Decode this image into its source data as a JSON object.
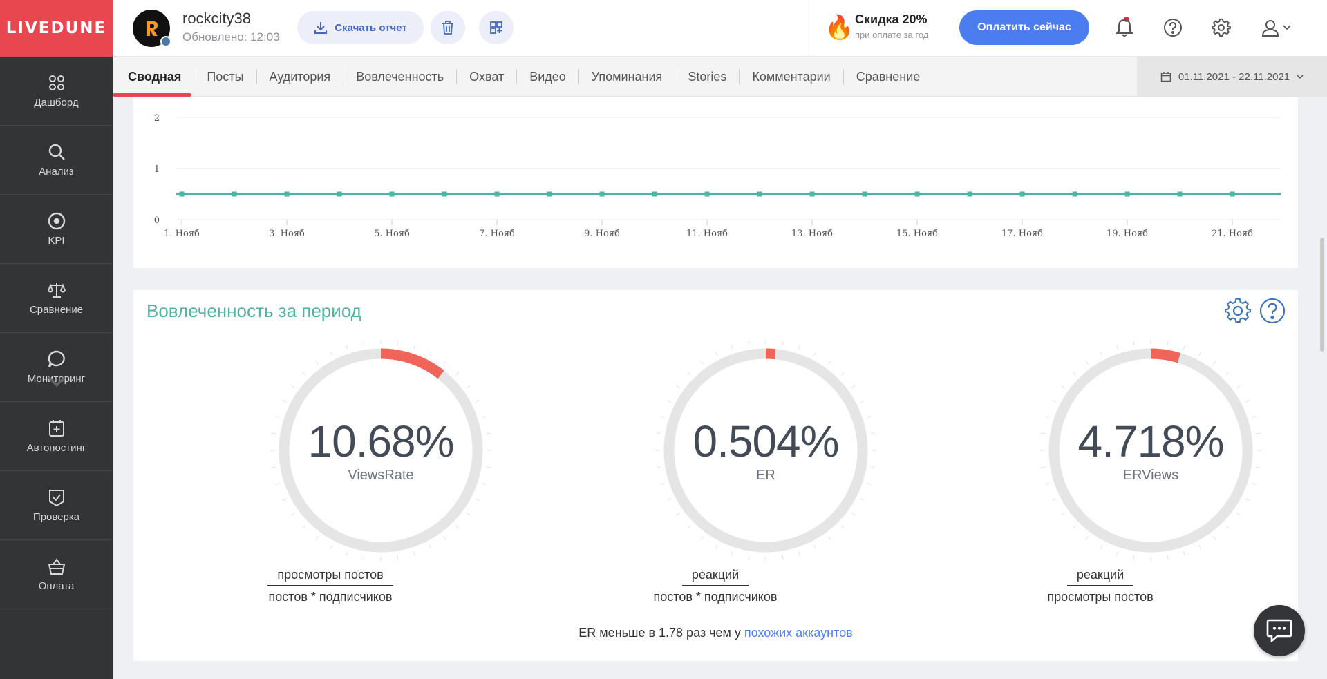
{
  "app": {
    "logo": "LIVEDUNE"
  },
  "sidebar": {
    "items": [
      {
        "label": "Дашборд",
        "icon": "dashboard-icon"
      },
      {
        "label": "Анализ",
        "icon": "search-icon"
      },
      {
        "label": "KPI",
        "icon": "target-icon"
      },
      {
        "label": "Сравнение",
        "icon": "scales-icon"
      },
      {
        "label": "Мониторинг",
        "icon": "chat-bubble-icon"
      },
      {
        "label": "Автопостинг",
        "icon": "calendar-plus-icon"
      },
      {
        "label": "Проверка",
        "icon": "shield-check-icon"
      },
      {
        "label": "Оплата",
        "icon": "basket-icon"
      }
    ]
  },
  "header": {
    "account_name": "rockcity38",
    "updated": "Обновлено: 12:03",
    "download_label": "Скачать отчет",
    "promo_title": "Скидка 20%",
    "promo_sub": "при оплате за год",
    "pay_label": "Оплатить сейчас"
  },
  "tabs": {
    "items": [
      "Сводная",
      "Посты",
      "Аудитория",
      "Вовлеченность",
      "Охват",
      "Видео",
      "Упоминания",
      "Stories",
      "Комментарии",
      "Сравнение"
    ],
    "active": "Сводная",
    "date_range": "01.11.2021 - 22.11.2021"
  },
  "chart_data": {
    "type": "line",
    "x": [
      "1. Нояб",
      "2. Нояб",
      "3. Нояб",
      "4. Нояб",
      "5. Нояб",
      "6. Нояб",
      "7. Нояб",
      "8. Нояб",
      "9. Нояб",
      "10. Нояб",
      "11. Нояб",
      "12. Нояб",
      "13. Нояб",
      "14. Нояб",
      "15. Нояб",
      "16. Нояб",
      "17. Нояб",
      "18. Нояб",
      "19. Нояб",
      "20. Нояб",
      "21. Нояб"
    ],
    "tick_labels": [
      "1. Нояб",
      "3. Нояб",
      "5. Нояб",
      "7. Нояб",
      "9. Нояб",
      "11. Нояб",
      "13. Нояб",
      "15. Нояб",
      "17. Нояб",
      "19. Нояб",
      "21. Нояб"
    ],
    "series": [
      {
        "values": [
          0.5,
          0.5,
          0.5,
          0.5,
          0.5,
          0.5,
          0.5,
          0.5,
          0.5,
          0.5,
          0.5,
          0.5,
          0.5,
          0.5,
          0.5,
          0.5,
          0.5,
          0.5,
          0.5,
          0.5,
          0.5
        ],
        "color": "#4fb3a1"
      }
    ],
    "y_ticks": [
      "0",
      "1",
      "2"
    ],
    "ylim": [
      0,
      2
    ],
    "grid": true
  },
  "engagement": {
    "title": "Вовлеченность за период",
    "gauges": [
      {
        "value": "10.68%",
        "label": "ViewsRate",
        "fraction": 0.1068,
        "numerator": "просмотры постов",
        "denominator": "постов * подписчиков"
      },
      {
        "value": "0.504%",
        "label": "ER",
        "fraction": 0.0154,
        "numerator": "реакций",
        "denominator": "постов * подписчиков"
      },
      {
        "value": "4.718%",
        "label": "ERViews",
        "fraction": 0.0472,
        "numerator": "реакций",
        "denominator": "просмотры постов"
      }
    ],
    "compare_text": "ER меньше в 1.78 раз чем у ",
    "compare_link": "похожих аккаунтов",
    "accent_color": "#f0655a",
    "track_color": "#e5e5e5"
  }
}
